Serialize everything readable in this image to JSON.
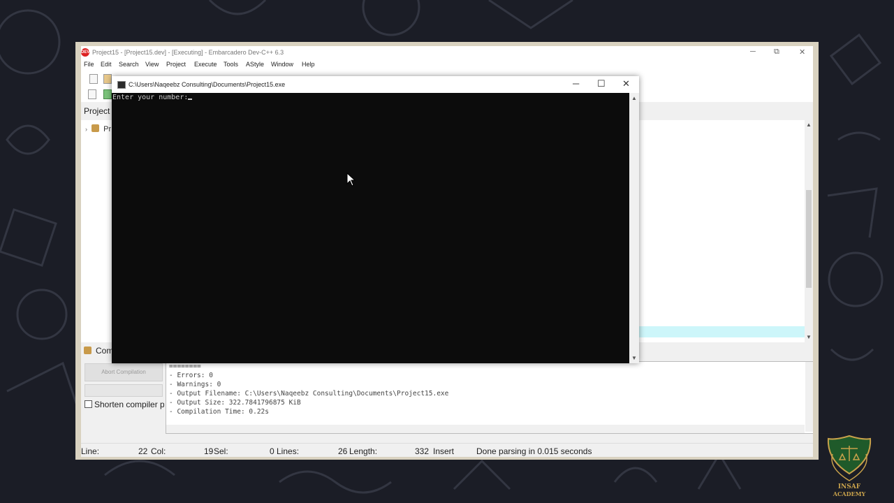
{
  "ide": {
    "title": "Project15 - [Project15.dev] - [Executing] - Embarcadero Dev-C++ 6.3",
    "logo_text": "DEV",
    "window_controls": {
      "minimize": "─",
      "restore": "⧉",
      "close": "✕"
    },
    "menu": [
      "File",
      "Edit",
      "Search",
      "View",
      "Project",
      "Execute",
      "Tools",
      "AStyle",
      "Window",
      "Help"
    ],
    "project_panel": {
      "header": "Project",
      "tree_item": "Pr"
    },
    "bottom_panel": {
      "tab_label": "Com",
      "abort_button": "Abort Compilation",
      "shorten_label": "Shorten compiler paths",
      "log_lines": [
        "========",
        "- Errors: 0",
        "- Warnings: 0",
        "- Output Filename: C:\\Users\\Naqeebz Consulting\\Documents\\Project15.exe",
        "- Output Size: 322.7841796875 KiB",
        "- Compilation Time: 0.22s"
      ]
    },
    "status": {
      "line_label": "Line:",
      "line_value": "22",
      "col_label": "Col:",
      "col_value": "19",
      "sel_label": "Sel:",
      "sel_value": "0",
      "lines_label": "Lines:",
      "lines_value": "26",
      "length_label": "Length:",
      "length_value": "332",
      "mode": "Insert",
      "message": "Done parsing in 0.015 seconds"
    }
  },
  "console": {
    "title": "C:\\Users\\Naqeebz Consulting\\Documents\\Project15.exe",
    "prompt": "Enter your number:",
    "controls": {
      "minimize": "─",
      "maximize": "☐",
      "close": "✕"
    },
    "scroll_up": "▲",
    "scroll_down": "▼"
  },
  "branding": {
    "line1": "INSAF",
    "line2": "ACADEMY"
  },
  "colors": {
    "background": "#1b1d26",
    "frame": "#d9d2c0",
    "console_bg": "#0c0c0c",
    "highlight_line": "#cdf6fa",
    "logo_gold": "#c9a24b",
    "logo_green": "#1f5a2a"
  }
}
